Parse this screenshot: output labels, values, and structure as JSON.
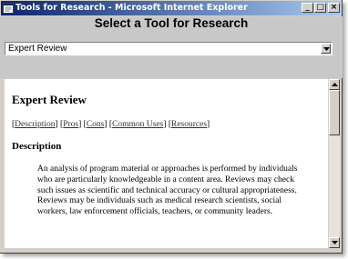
{
  "window": {
    "title": "Tools for Research - Microsoft Internet Explorer",
    "minimize_glyph": "_",
    "maximize_glyph": "□",
    "close_glyph": "×"
  },
  "header": {
    "title": "Select a Tool for Research",
    "select": {
      "value": "Expert Review"
    }
  },
  "content": {
    "heading": "Expert Review",
    "links": [
      {
        "label": "Description"
      },
      {
        "label": "Pros"
      },
      {
        "label": "Cons"
      },
      {
        "label": "Common Uses"
      },
      {
        "label": "Resources"
      }
    ],
    "section_heading": "Description",
    "paragraph": "An analysis of program material or approaches is performed by individuals who are particularly knowledgeable in a content area. Reviews may check such issues as scientific and technical accuracy or cultural appropriateness. Reviews may be individuals such as medical research scientists, social workers, law enforcement officials, teachers, or community leaders."
  },
  "colors": {
    "titlebar_start": "#0a246a",
    "titlebar_end": "#a6caf0",
    "header_bg": "#c8c8c8",
    "chrome": "#d4d0c8"
  },
  "icons": [
    "ie-window-icon",
    "minimize-icon",
    "maximize-icon",
    "close-icon",
    "dropdown-arrow-icon",
    "scroll-up-arrow-icon",
    "scroll-down-arrow-icon"
  ]
}
